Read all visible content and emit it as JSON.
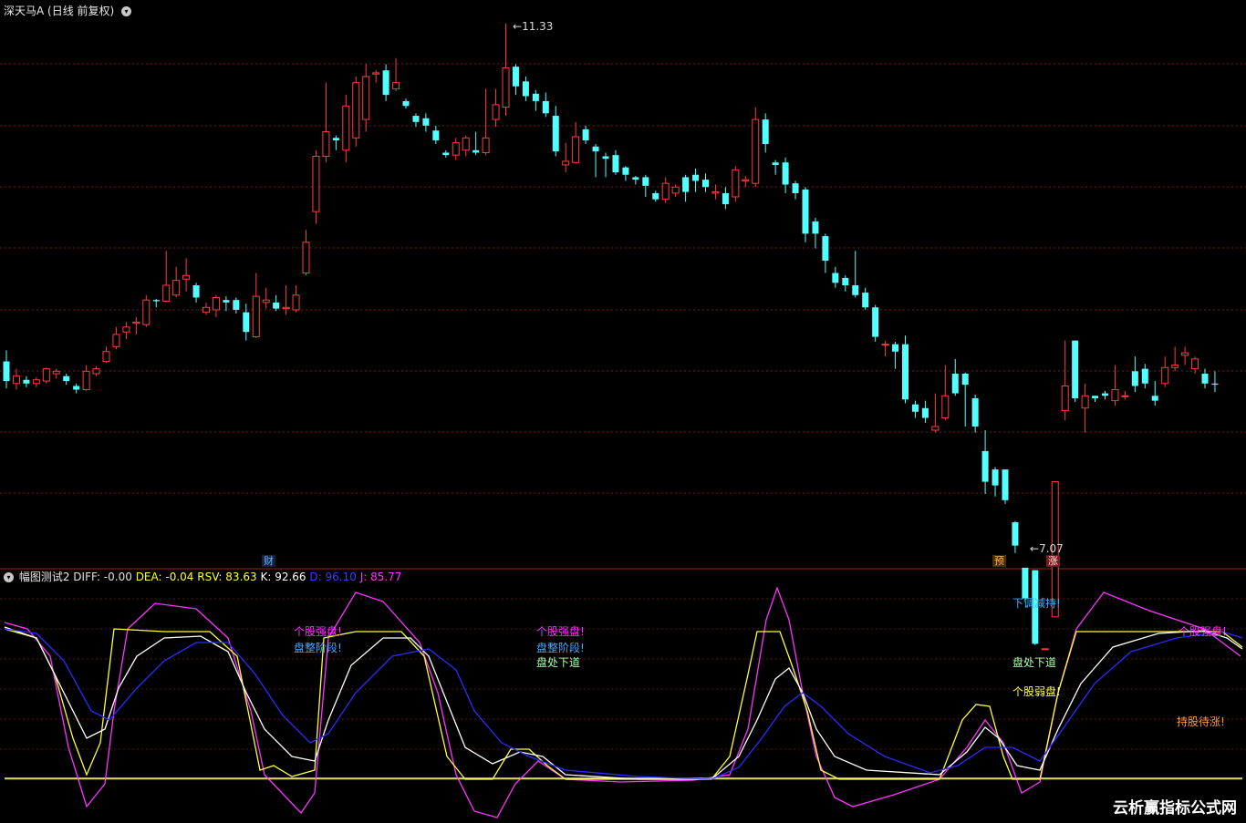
{
  "header": {
    "title": "深天马A",
    "period": "(日线 前复权)",
    "menu_icon": "chevron-down-icon"
  },
  "price_labels": {
    "high": "11.33",
    "low": "7.07"
  },
  "markers": {
    "cai": "财",
    "yu": "预",
    "zhang": "涨"
  },
  "indicator": {
    "name": "幅图测试2",
    "diff_label": "DIFF: -0.00",
    "dea_label": "DEA: -0.04",
    "rsv_label": "RSV: 83.63",
    "k_label": "K: 92.66",
    "d_label": "D: 96.10",
    "j_label": "J: 85.77",
    "colors": {
      "diff": "#e0e0e0",
      "dea": "#ffff33",
      "rsv": "#ffff33",
      "k": "#ffffff",
      "d": "#2b2bff",
      "j": "#ff33ff"
    }
  },
  "signals": {
    "qiang1": "个股强盘!",
    "zheng1": "盘整阶段!",
    "qiang2": "个股强盘!",
    "zheng2": "盘整阶段!",
    "xia1": "盘处下道",
    "tiao": "下调减持!",
    "xia2": "盘处下道",
    "ruo": "个股弱盘!",
    "qiang3": "个股强盘!",
    "dai": "持股待涨!"
  },
  "watermark": "云析赢指标公式网",
  "chart_data": [
    {
      "type": "candlestick",
      "title": "深天马A (日线 前复权)",
      "y_range": [
        7.07,
        11.33
      ],
      "high_label": "11.33",
      "low_label": "7.07",
      "grid": true,
      "candles": [
        [
          8.58,
          8.42,
          8.67,
          8.36
        ],
        [
          8.4,
          8.46,
          8.52,
          8.35
        ],
        [
          8.43,
          8.4,
          8.46,
          8.37
        ],
        [
          8.4,
          8.43,
          8.45,
          8.37
        ],
        [
          8.42,
          8.52,
          8.53,
          8.4
        ],
        [
          8.48,
          8.5,
          8.52,
          8.44
        ],
        [
          8.46,
          8.42,
          8.48,
          8.39
        ],
        [
          8.38,
          8.35,
          8.4,
          8.32
        ],
        [
          8.35,
          8.5,
          8.55,
          8.34
        ],
        [
          8.48,
          8.52,
          8.54,
          8.46
        ],
        [
          8.58,
          8.66,
          8.7,
          8.57
        ],
        [
          8.7,
          8.8,
          8.86,
          8.68
        ],
        [
          8.82,
          8.86,
          8.9,
          8.76
        ],
        [
          8.89,
          8.9,
          8.94,
          8.8
        ],
        [
          8.88,
          9.08,
          9.12,
          8.86
        ],
        [
          9.08,
          9.07,
          9.09,
          9.02
        ],
        [
          9.07,
          9.2,
          9.48,
          9.06
        ],
        [
          9.12,
          9.24,
          9.35,
          9.1
        ],
        [
          9.25,
          9.28,
          9.42,
          9.15
        ],
        [
          9.2,
          9.1,
          9.22,
          9.06
        ],
        [
          8.98,
          9.02,
          9.06,
          8.96
        ],
        [
          9.0,
          9.1,
          9.12,
          8.94
        ],
        [
          9.08,
          9.06,
          9.11,
          8.99
        ],
        [
          9.08,
          9.0,
          9.1,
          8.97
        ],
        [
          8.98,
          8.82,
          9.05,
          8.75
        ],
        [
          8.78,
          9.11,
          9.3,
          8.77
        ],
        [
          9.06,
          9.08,
          9.18,
          9.01
        ],
        [
          9.06,
          9.01,
          9.12,
          8.99
        ],
        [
          9.01,
          9.02,
          9.2,
          8.96
        ],
        [
          9.0,
          9.12,
          9.2,
          8.98
        ],
        [
          9.3,
          9.55,
          9.65,
          9.28
        ],
        [
          9.8,
          10.25,
          10.3,
          9.7
        ],
        [
          10.25,
          10.45,
          10.85,
          10.2
        ],
        [
          10.4,
          10.38,
          10.42,
          10.3
        ],
        [
          10.3,
          10.66,
          10.75,
          10.2
        ],
        [
          10.4,
          10.85,
          10.9,
          10.33
        ],
        [
          10.55,
          10.9,
          11.0,
          10.45
        ],
        [
          10.92,
          10.93,
          10.95,
          10.85
        ],
        [
          10.95,
          10.75,
          11.0,
          10.7
        ],
        [
          10.8,
          10.85,
          11.05,
          10.78
        ],
        [
          10.7,
          10.66,
          10.72,
          10.64
        ],
        [
          10.58,
          10.53,
          10.6,
          10.49
        ],
        [
          10.56,
          10.5,
          10.6,
          10.45
        ],
        [
          10.46,
          10.38,
          10.5,
          10.35
        ],
        [
          10.28,
          10.26,
          10.3,
          10.24
        ],
        [
          10.26,
          10.36,
          10.4,
          10.22
        ],
        [
          10.3,
          10.4,
          10.42,
          10.25
        ],
        [
          10.3,
          10.28,
          10.45,
          10.26
        ],
        [
          10.28,
          10.4,
          10.8,
          10.26
        ],
        [
          10.55,
          10.67,
          10.8,
          10.49
        ],
        [
          10.65,
          10.97,
          11.33,
          10.58
        ],
        [
          10.98,
          10.82,
          11.0,
          10.75
        ],
        [
          10.86,
          10.74,
          10.9,
          10.7
        ],
        [
          10.76,
          10.7,
          10.79,
          10.62
        ],
        [
          10.7,
          10.6,
          10.77,
          10.57
        ],
        [
          10.58,
          10.29,
          10.66,
          10.25
        ],
        [
          10.18,
          10.21,
          10.36,
          10.12
        ],
        [
          10.2,
          10.41,
          10.53,
          10.19
        ],
        [
          10.47,
          10.38,
          10.5,
          10.35
        ],
        [
          10.33,
          10.29,
          10.35,
          10.08
        ],
        [
          10.25,
          10.23,
          10.28,
          10.08
        ],
        [
          10.26,
          10.12,
          10.3,
          10.1
        ],
        [
          10.16,
          10.1,
          10.17,
          10.05
        ],
        [
          10.08,
          10.06,
          10.09,
          10.02
        ],
        [
          10.08,
          10.01,
          10.1,
          9.92
        ],
        [
          9.95,
          9.9,
          9.97,
          9.88
        ],
        [
          9.9,
          10.03,
          10.08,
          9.87
        ],
        [
          9.95,
          10.0,
          10.02,
          9.92
        ],
        [
          10.08,
          9.96,
          10.1,
          9.88
        ],
        [
          10.1,
          10.05,
          10.15,
          9.96
        ],
        [
          10.06,
          10.0,
          10.11,
          9.96
        ],
        [
          9.95,
          9.96,
          10.02,
          9.9
        ],
        [
          9.95,
          9.86,
          10.0,
          9.82
        ],
        [
          9.92,
          10.14,
          10.17,
          9.88
        ],
        [
          10.05,
          10.06,
          10.09,
          10.0
        ],
        [
          10.03,
          10.55,
          10.65,
          10.0
        ],
        [
          10.55,
          10.35,
          10.6,
          10.28
        ],
        [
          10.2,
          10.18,
          10.22,
          10.1
        ],
        [
          10.2,
          10.02,
          10.24,
          9.95
        ],
        [
          10.03,
          9.95,
          10.05,
          9.9
        ],
        [
          9.98,
          9.62,
          10.0,
          9.55
        ],
        [
          9.72,
          9.62,
          9.75,
          9.5
        ],
        [
          9.6,
          9.4,
          9.62,
          9.3
        ],
        [
          9.3,
          9.22,
          9.35,
          9.18
        ],
        [
          9.26,
          9.2,
          9.28,
          9.15
        ],
        [
          9.2,
          9.12,
          9.48,
          9.1
        ],
        [
          9.14,
          9.02,
          9.18,
          9.0
        ],
        [
          9.02,
          8.78,
          9.04,
          8.74
        ],
        [
          8.72,
          8.72,
          8.75,
          8.62
        ],
        [
          8.72,
          8.66,
          8.74,
          8.52
        ],
        [
          8.72,
          8.27,
          8.79,
          8.24
        ],
        [
          8.23,
          8.17,
          8.26,
          8.12
        ],
        [
          8.2,
          8.12,
          8.26,
          8.08
        ],
        [
          8.02,
          8.05,
          8.32,
          8.0
        ],
        [
          8.12,
          8.3,
          8.55,
          8.1
        ],
        [
          8.48,
          8.32,
          8.6,
          8.3
        ],
        [
          8.48,
          8.39,
          8.49,
          8.05
        ],
        [
          8.28,
          8.05,
          8.31,
          8.0
        ],
        [
          7.85,
          7.6,
          8.02,
          7.5
        ],
        [
          7.7,
          7.57,
          7.72,
          7.48
        ],
        [
          7.7,
          7.45,
          7.7,
          7.42
        ],
        [
          7.27,
          7.08,
          7.28,
          7.02
        ],
        [
          6.9,
          6.65,
          6.9,
          6.63
        ],
        [
          6.88,
          6.28,
          6.88,
          6.27
        ],
        [
          6.24,
          6.24,
          7.07,
          7.07
        ],
        [
          6.5,
          7.6,
          7.6,
          6.5
        ],
        [
          8.18,
          8.38,
          8.75,
          8.1
        ],
        [
          8.75,
          8.28,
          8.75,
          8.25
        ],
        [
          8.2,
          8.3,
          8.4,
          8.0
        ],
        [
          8.3,
          8.28,
          8.3,
          8.25
        ],
        [
          8.32,
          8.3,
          8.34,
          8.27
        ],
        [
          8.26,
          8.35,
          8.55,
          8.22
        ],
        [
          8.3,
          8.3,
          8.34,
          8.27
        ],
        [
          8.5,
          8.38,
          8.62,
          8.33
        ],
        [
          8.52,
          8.4,
          8.56,
          8.36
        ],
        [
          8.3,
          8.26,
          8.42,
          8.22
        ],
        [
          8.4,
          8.53,
          8.62,
          8.37
        ],
        [
          8.53,
          8.55,
          8.7,
          8.5
        ],
        [
          8.63,
          8.65,
          8.7,
          8.55
        ],
        [
          8.52,
          8.6,
          8.62,
          8.48
        ],
        [
          8.48,
          8.4,
          8.52,
          8.36
        ],
        [
          8.4,
          8.39,
          8.5,
          8.33
        ]
      ]
    },
    {
      "type": "line",
      "title": "幅图测试2",
      "series": [
        {
          "name": "DIFF",
          "values": []
        },
        {
          "name": "DEA",
          "values": []
        },
        {
          "name": "RSV",
          "values": []
        },
        {
          "name": "K",
          "values": []
        },
        {
          "name": "D",
          "values": []
        },
        {
          "name": "J",
          "values": []
        }
      ],
      "last_values": {
        "DIFF": -0.0,
        "DEA": -0.04,
        "RSV": 83.63,
        "K": 92.66,
        "D": 96.1,
        "J": 85.77
      }
    }
  ]
}
